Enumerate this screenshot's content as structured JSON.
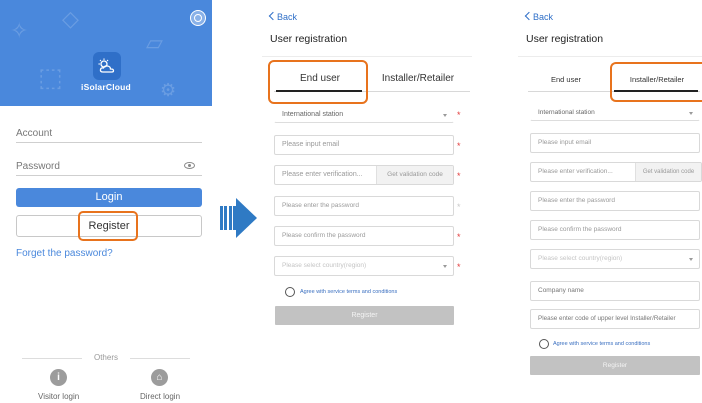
{
  "login": {
    "app_name": "iSolarCloud",
    "account_label": "Account",
    "password_label": "Password",
    "login_button": "Login",
    "register_button": "Register",
    "forget_link": "Forget the password?",
    "others_label": "Others",
    "visitor_login": "Visitor login",
    "direct_login": "Direct login"
  },
  "register_end_user": {
    "back": "Back",
    "title": "User registration",
    "tabs": [
      "End user",
      "Installer/Retailer"
    ],
    "active_tab": "End user",
    "station": "International station",
    "email_placeholder": "Please input email",
    "code_placeholder": "Please enter verification...",
    "code_button": "Get validation code",
    "password_placeholder": "Please enter the password",
    "confirm_placeholder": "Please confirm the password",
    "country_placeholder": "Please select country(region)",
    "agree_text": "Agree with service terms and conditions",
    "submit": "Register",
    "required_mark": "*"
  },
  "register_installer": {
    "back": "Back",
    "title": "User registration",
    "tabs": [
      "End user",
      "Installer/Retailer"
    ],
    "active_tab": "Installer/Retailer",
    "station": "International station",
    "email_placeholder": "Please input email",
    "code_placeholder": "Please enter verification...",
    "code_button": "Get validation code",
    "password_placeholder": "Please enter the password",
    "confirm_placeholder": "Please confirm the password",
    "country_placeholder": "Please select country(region)",
    "company_placeholder": "Company name",
    "upper_code_placeholder": "Please enter code of upper level Installer/Retailer",
    "agree_text": "Agree with service terms and conditions",
    "submit": "Register"
  },
  "colors": {
    "brand_blue": "#4a88dc",
    "highlight_orange": "#e8731d",
    "arrow_blue": "#2f7ac4",
    "required_red": "#e23b3b"
  }
}
